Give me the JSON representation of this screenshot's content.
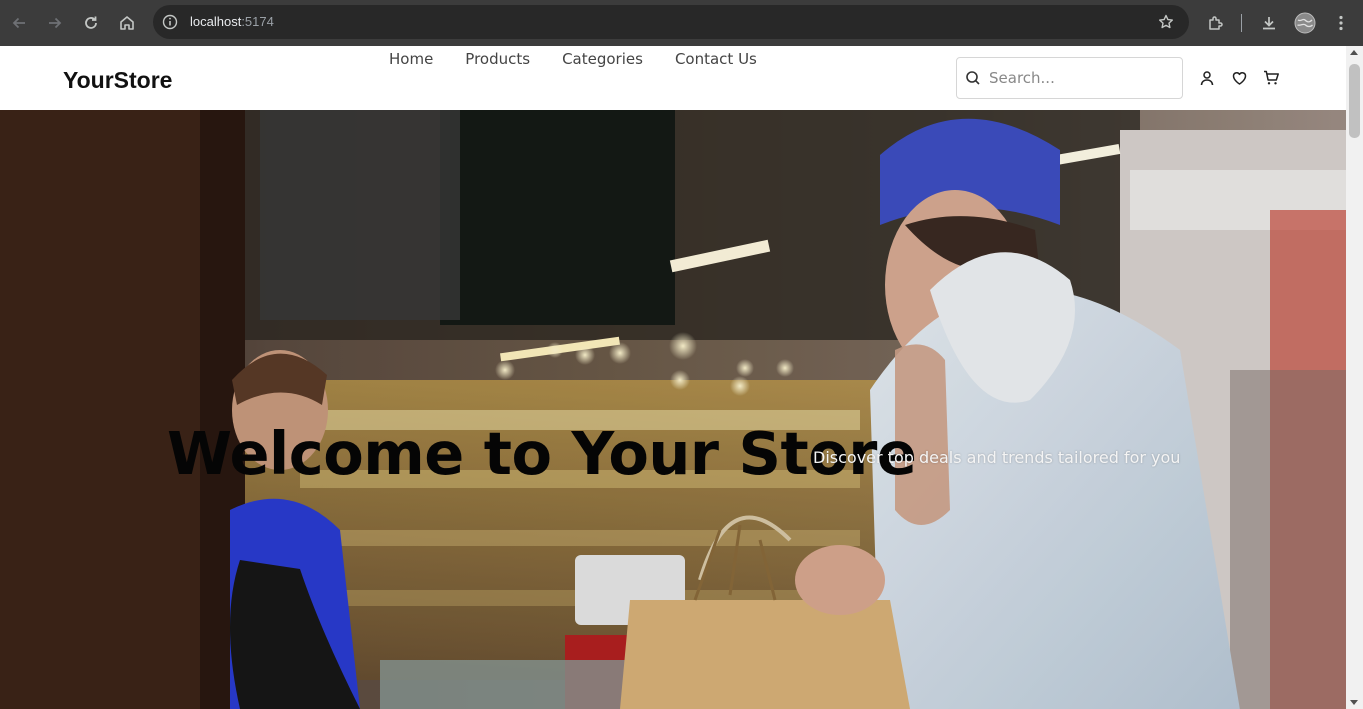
{
  "browser": {
    "url_host": "localhost",
    "url_port": ":5174",
    "colors": {
      "frame": "#3c3c3c",
      "omnibox": "#282828",
      "icon": "#c4c7c5"
    }
  },
  "header": {
    "brand": "YourStore",
    "nav": [
      {
        "label": "Home"
      },
      {
        "label": "Products"
      },
      {
        "label": "Categories"
      },
      {
        "label": "Contact Us"
      }
    ],
    "search": {
      "placeholder": "Search...",
      "value": ""
    },
    "icons": [
      "user-icon",
      "heart-icon",
      "cart-icon"
    ]
  },
  "hero": {
    "title": "Welcome to Your Store",
    "subtitle": "Discover top deals and trends tailored for you"
  }
}
